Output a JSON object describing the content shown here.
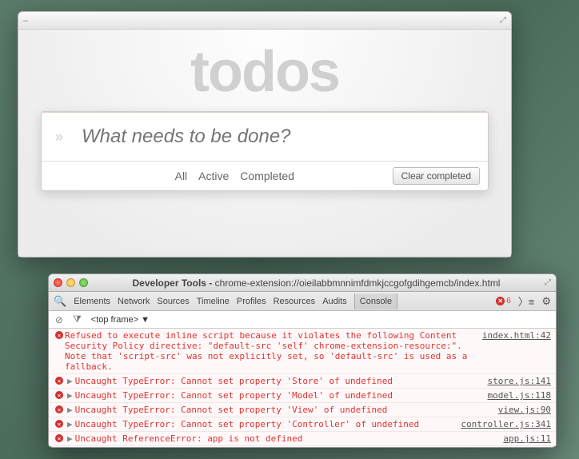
{
  "app": {
    "title": "todos",
    "toggle_all_icon": "»",
    "input_placeholder": "What needs to be done?",
    "filters": {
      "all": "All",
      "active": "Active",
      "completed": "Completed"
    },
    "clear_label": "Clear completed"
  },
  "devtools": {
    "window_title_prefix": "Developer Tools - ",
    "window_title_url": "chrome-extension://oieilabbmnnimfdmkjccgofgdihgemcb/index.html",
    "tabs": [
      "Elements",
      "Network",
      "Sources",
      "Timeline",
      "Profiles",
      "Resources",
      "Audits",
      "Console"
    ],
    "active_tab": "Console",
    "error_count": "6",
    "frame_label": "<top frame> ▼",
    "messages": [
      {
        "expandable": false,
        "text": "Refused to execute inline script because it violates the following Content Security Policy directive: \"default-src 'self' chrome-extension-resource:\". Note that 'script-src' was not explicitly set, so 'default-src' is used as a fallback.",
        "source": "index.html:42"
      },
      {
        "expandable": true,
        "text": "Uncaught TypeError: Cannot set property 'Store' of undefined",
        "source": "store.js:141"
      },
      {
        "expandable": true,
        "text": "Uncaught TypeError: Cannot set property 'Model' of undefined",
        "source": "model.js:118"
      },
      {
        "expandable": true,
        "text": "Uncaught TypeError: Cannot set property 'View' of undefined",
        "source": "view.js:90"
      },
      {
        "expandable": true,
        "text": "Uncaught TypeError: Cannot set property 'Controller' of undefined",
        "source": "controller.js:341"
      },
      {
        "expandable": true,
        "text": "Uncaught ReferenceError: app is not defined",
        "source": "app.js:11"
      }
    ]
  }
}
